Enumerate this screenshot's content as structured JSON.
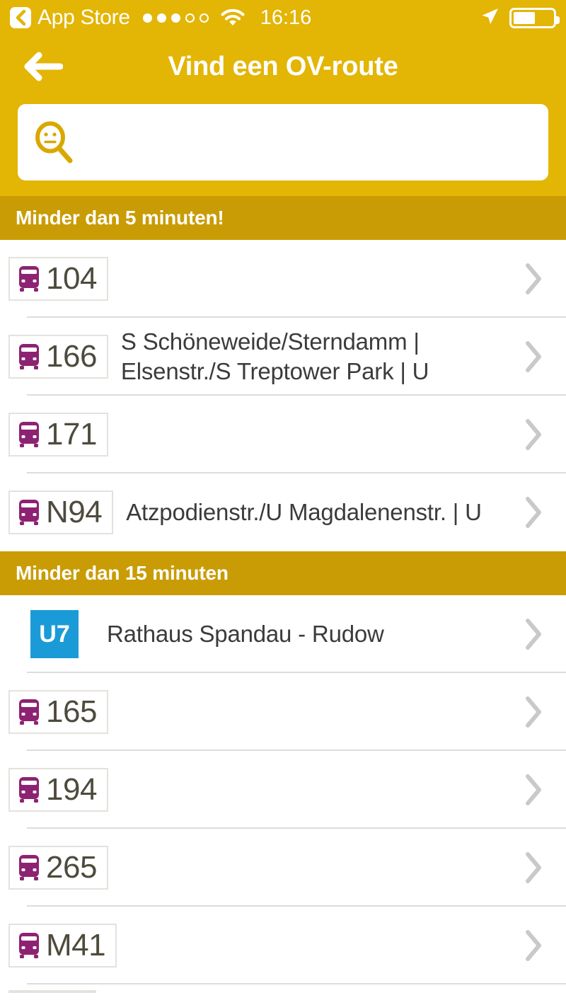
{
  "status_bar": {
    "back_app_label": "App Store",
    "signal_dots_filled": 3,
    "signal_dots_total": 5,
    "wifi_icon": "wifi-icon",
    "time": "16:16",
    "location_icon": "location-arrow-icon",
    "battery_icon": "battery-icon",
    "battery_percent": 55
  },
  "header": {
    "back_icon": "back-arrow-icon",
    "title": "Vind een OV-route",
    "background_color": "#E3B505"
  },
  "search": {
    "icon": "search-face-magnifier-icon",
    "value": "",
    "placeholder": ""
  },
  "sections": [
    {
      "title": "Minder dan 5 minuten!",
      "background_color": "#C99C05",
      "rows": [
        {
          "type": "bus",
          "icon": "bus-icon",
          "line": "104",
          "description": ""
        },
        {
          "type": "bus",
          "icon": "bus-icon",
          "line": "166",
          "description": "S Schöneweide/Sterndamm | Elsenstr./S Treptower Park | U"
        },
        {
          "type": "bus",
          "icon": "bus-icon",
          "line": "171",
          "description": ""
        },
        {
          "type": "bus",
          "icon": "bus-icon",
          "line": "N94",
          "description": "Atzpodienstr./U Magdalenenstr. | U"
        }
      ]
    },
    {
      "title": "Minder dan 15 minuten",
      "background_color": "#C99C05",
      "rows": [
        {
          "type": "metro",
          "badge_color": "#1A9BD7",
          "line": "U7",
          "description": "Rathaus Spandau - Rudow"
        },
        {
          "type": "bus",
          "icon": "bus-icon",
          "line": "165",
          "description": ""
        },
        {
          "type": "bus",
          "icon": "bus-icon",
          "line": "194",
          "description": ""
        },
        {
          "type": "bus",
          "icon": "bus-icon",
          "line": "265",
          "description": ""
        },
        {
          "type": "bus",
          "icon": "bus-icon",
          "line": "M41",
          "description": ""
        }
      ]
    }
  ],
  "chevron_icon": "chevron-right-icon",
  "colors": {
    "header_gold": "#E3B505",
    "section_gold": "#C99C05",
    "bus_purple": "#8E2272",
    "metro_blue": "#1A9BD7",
    "route_number": "#4e4b3d"
  }
}
